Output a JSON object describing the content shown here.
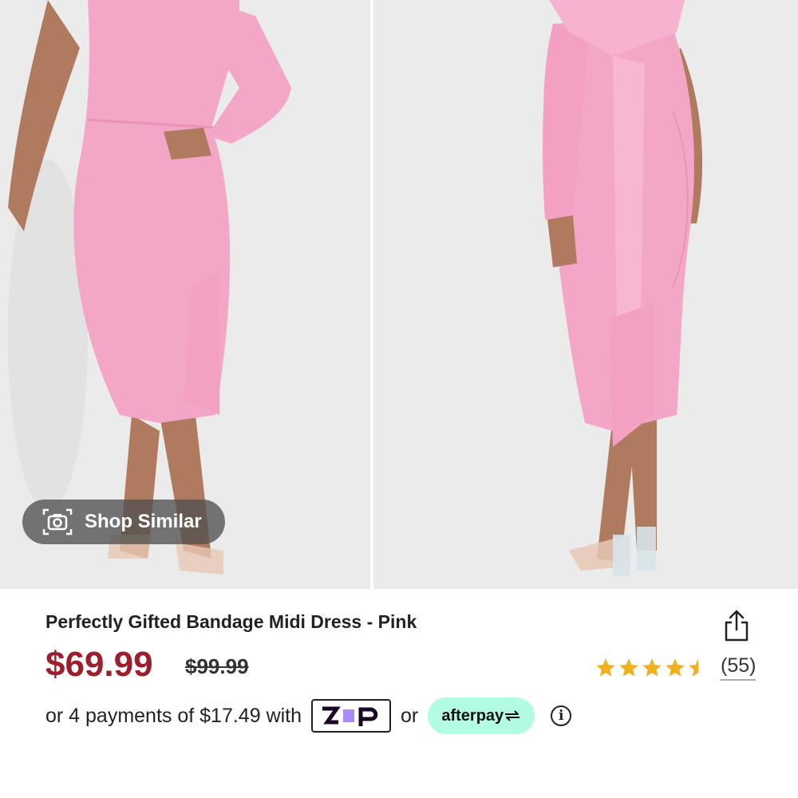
{
  "gallery": {
    "images": [
      {
        "alt": "model front view"
      },
      {
        "alt": "model back view"
      }
    ],
    "shop_similar_label": "Shop Similar"
  },
  "product": {
    "title": "Perfectly Gifted Bandage Midi Dress - Pink",
    "price": "$69.99",
    "original_price": "$99.99",
    "rating": 4.5,
    "review_count": "(55)"
  },
  "payments": {
    "prefix": "or 4 payments of $17.49 with",
    "zip_label": "ZIP",
    "or_label": "or",
    "afterpay_label": "afterpay",
    "info_icon": "i"
  },
  "colors": {
    "price": "#9b1f2c",
    "star": "#f2b01e",
    "afterpay_bg": "#b2fce4",
    "zip_accent": "#a98bff"
  }
}
